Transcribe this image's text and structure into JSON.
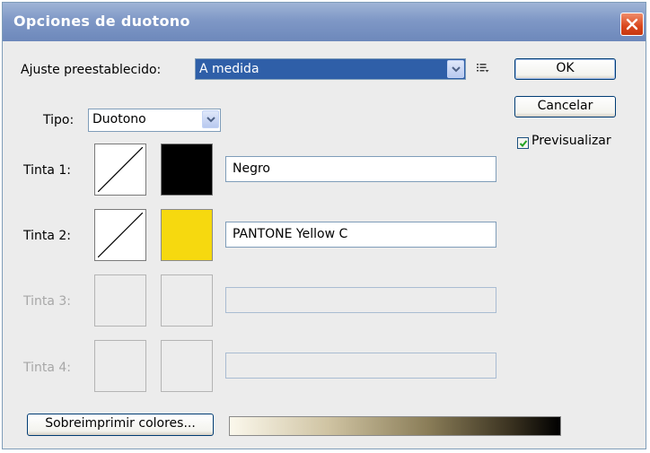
{
  "window": {
    "title": "Opciones de duotono"
  },
  "preset": {
    "label": "Ajuste preestablecido:",
    "value": "A medida"
  },
  "type": {
    "label": "Tipo:",
    "value": "Duotono"
  },
  "inks": [
    {
      "label": "Tinta 1:",
      "name": "Negro",
      "color": "#000000"
    },
    {
      "label": "Tinta 2:",
      "name": "PANTONE Yellow C",
      "color": "#f6d90f"
    },
    {
      "label": "Tinta 3:",
      "name": ""
    },
    {
      "label": "Tinta 4:",
      "name": ""
    }
  ],
  "buttons": {
    "ok": "OK",
    "cancel": "Cancelar",
    "overprint": "Sobreimprimir colores..."
  },
  "preview": {
    "label": "Previsualizar",
    "checked": true
  },
  "colors": {
    "titlebar": "#7f98c6",
    "dialog_bg": "#ececec",
    "ramp_dark": "#000000",
    "ramp_light": "#fbf8ec"
  }
}
